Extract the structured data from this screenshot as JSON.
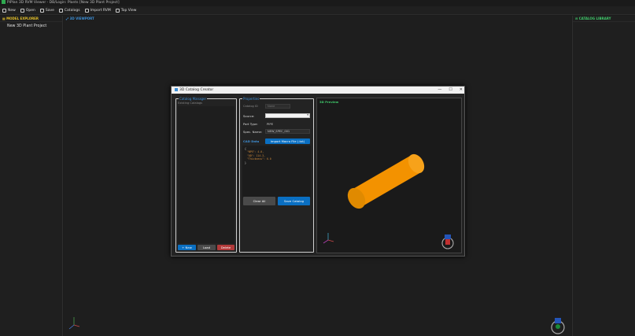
{
  "window": {
    "title": "PiPlan 3D RVM Viewer - DB/Login: Plants [New 3D Plant Project]"
  },
  "toolbar": {
    "items": [
      {
        "label": "New",
        "icon": "new-file-icon"
      },
      {
        "label": "Open",
        "icon": "folder-open-icon"
      },
      {
        "label": "Save",
        "icon": "save-icon"
      },
      {
        "label": "Catalogs",
        "icon": "catalog-icon"
      },
      {
        "label": "Import RVM",
        "icon": "import-icon"
      },
      {
        "label": "Top View",
        "icon": "view-icon"
      }
    ]
  },
  "left_panel": {
    "header": "MODEL EXPLORER",
    "items": [
      "New 3D Plant Project"
    ]
  },
  "center_panel": {
    "header": "3D VIEWPORT"
  },
  "right_panel": {
    "header": "CATALOG LIBRARY"
  },
  "dialog": {
    "title": "3D Catalog Creator",
    "buttons": {
      "minimize": "—",
      "maximize": "☐",
      "close": "✕"
    },
    "catalog_manager": {
      "label": "Catalog Manager",
      "sublabel": "Existing Catalogs",
      "new_label": "+ New",
      "load_label": "Load",
      "delete_label": "Delete"
    },
    "properties": {
      "label": "Properties",
      "catalog_id_label": "Catalog ID",
      "catalog_id_value": "None",
      "source_label": "Source:",
      "part_type_label": "Part Type:",
      "part_type_value": "PIPE",
      "spec_name_label": "Spec. Name:",
      "spec_name_value": "NEW_SPEC_001",
      "cad_data_label": "CAD Data",
      "import_label": "Import Macro File (.txt)",
      "json_open": "{",
      "json_lines": [
        "\"NPS\": 4.0,",
        "\"OD\": 114.3,",
        "\"Thickness\": 6.0"
      ],
      "json_close": "}",
      "clear_label": "Clear All",
      "save_label": "Save Catalog"
    },
    "preview": {
      "label": "3D Preview"
    }
  },
  "colors": {
    "accent_blue": "#0a6fc2",
    "pipe_orange": "#f39200",
    "delete_red": "#b23a3a"
  }
}
